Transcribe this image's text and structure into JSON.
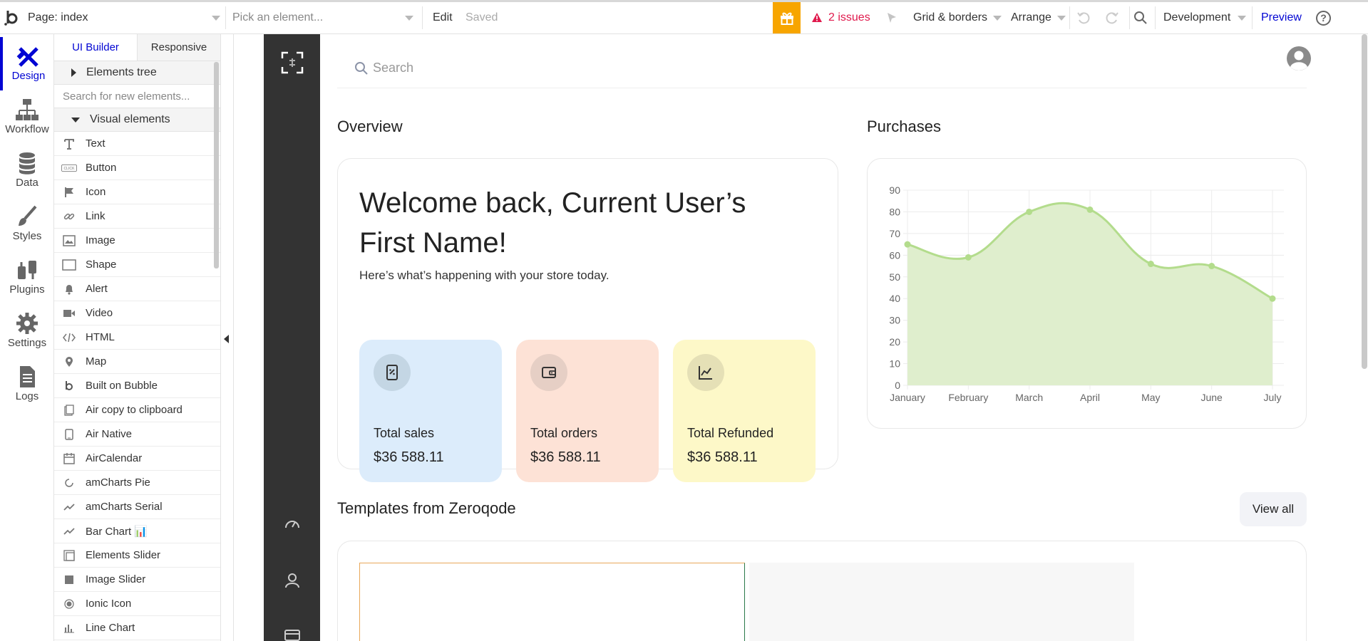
{
  "topbar": {
    "page_label": "Page: index",
    "element_picker_placeholder": "Pick an element...",
    "edit_label": "Edit",
    "saved_label": "Saved",
    "issues_label": "2 issues",
    "grid_label": "Grid & borders",
    "arrange_label": "Arrange",
    "environment_label": "Development",
    "preview_label": "Preview",
    "help_label": "?",
    "accent_color": "#f7a500",
    "issue_color": "#e0194c",
    "link_color": "#0205d3"
  },
  "rail": {
    "items": [
      {
        "label": "Design",
        "icon": "design-icon",
        "active": true
      },
      {
        "label": "Workflow",
        "icon": "workflow-icon"
      },
      {
        "label": "Data",
        "icon": "database-icon"
      },
      {
        "label": "Styles",
        "icon": "brush-icon"
      },
      {
        "label": "Plugins",
        "icon": "plug-icon"
      },
      {
        "label": "Settings",
        "icon": "gear-icon"
      },
      {
        "label": "Logs",
        "icon": "document-icon"
      }
    ]
  },
  "panel": {
    "tabs": [
      "UI Builder",
      "Responsive"
    ],
    "elements_tree_label": "Elements tree",
    "search_placeholder": "Search for new elements...",
    "visual_elements_label": "Visual elements",
    "elements": [
      {
        "label": "Text",
        "icon": "text-icon"
      },
      {
        "label": "Button",
        "icon": "button-icon"
      },
      {
        "label": "Icon",
        "icon": "flag-icon"
      },
      {
        "label": "Link",
        "icon": "link-icon"
      },
      {
        "label": "Image",
        "icon": "image-icon"
      },
      {
        "label": "Shape",
        "icon": "shape-icon"
      },
      {
        "label": "Alert",
        "icon": "bell-icon"
      },
      {
        "label": "Video",
        "icon": "video-icon"
      },
      {
        "label": "HTML",
        "icon": "code-icon"
      },
      {
        "label": "Map",
        "icon": "map-pin-icon"
      },
      {
        "label": "Built on Bubble",
        "icon": "bubble-logo-icon"
      },
      {
        "label": "Air copy to clipboard",
        "icon": "clipboard-icon"
      },
      {
        "label": "Air Native",
        "icon": "phone-icon"
      },
      {
        "label": "AirCalendar",
        "icon": "calendar-icon"
      },
      {
        "label": "amCharts Pie",
        "icon": "pie-icon"
      },
      {
        "label": "amCharts Serial",
        "icon": "trend-icon"
      },
      {
        "label": "Bar Chart 📊",
        "icon": "trend-icon"
      },
      {
        "label": "Elements Slider",
        "icon": "slider-icon"
      },
      {
        "label": "Image Slider",
        "icon": "square-icon"
      },
      {
        "label": "Ionic Icon",
        "icon": "radio-icon"
      },
      {
        "label": "Line Chart",
        "icon": "bar-icon"
      }
    ]
  },
  "canvas": {
    "search_placeholder": "Search",
    "overview_title": "Overview",
    "purchases_title": "Purchases",
    "welcome_title": "Welcome back, Current User’s First Name!",
    "welcome_subtitle": "Here’s what’s happening with your store today.",
    "stats": [
      {
        "label": "Total sales",
        "value": "$36 588.11",
        "bg": "#dcecfb",
        "circle": "#c4d6e4",
        "icon": "receipt-icon"
      },
      {
        "label": "Total orders",
        "value": "$36 588.11",
        "bg": "#fde2d6",
        "circle": "#e6cfc5",
        "icon": "wallet-icon"
      },
      {
        "label": "Total Refunded",
        "value": "$36 588.11",
        "bg": "#fdf8c8",
        "circle": "#e5e0b6",
        "icon": "chart-icon"
      }
    ],
    "templates_title": "Templates from Zeroqode",
    "view_all_label": "View all",
    "sidebar_icons": [
      "fullscreen-icon",
      "dashboard-icon",
      "user-icon",
      "card-icon"
    ]
  },
  "chart_data": {
    "type": "area",
    "categories": [
      "January",
      "February",
      "March",
      "April",
      "May",
      "June",
      "July"
    ],
    "values": [
      65,
      59,
      80,
      81,
      56,
      55,
      40
    ],
    "ylim": [
      0,
      90
    ],
    "yticks": [
      0,
      10,
      20,
      30,
      40,
      50,
      60,
      70,
      80,
      90
    ],
    "grid": true,
    "line_color": "#b3dc8c",
    "fill_color": "#dfeecd"
  }
}
